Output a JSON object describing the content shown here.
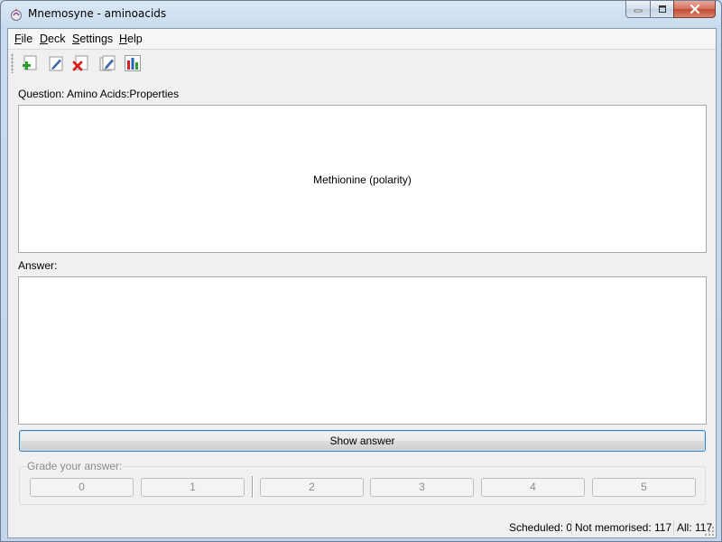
{
  "window": {
    "title": "Mnemosyne - aminoacids"
  },
  "menu": [
    {
      "label": "File",
      "underline": "F",
      "rest": "ile"
    },
    {
      "label": "Deck",
      "underline": "D",
      "rest": "eck"
    },
    {
      "label": "Settings",
      "underline": "S",
      "rest": "ettings"
    },
    {
      "label": "Help",
      "underline": "H",
      "rest": "elp"
    }
  ],
  "toolbar": {
    "icons": [
      "add-card-icon",
      "edit-card-icon",
      "delete-card-icon",
      "edit-deck-icon",
      "statistics-icon"
    ]
  },
  "question": {
    "label": "Question: Amino Acids:Properties",
    "text": "Methionine (polarity)"
  },
  "answer": {
    "label": "Answer:",
    "text": ""
  },
  "show_answer_label": "Show answer",
  "grade": {
    "legend": "Grade your answer:",
    "buttons": [
      "0",
      "1",
      "2",
      "3",
      "4",
      "5"
    ]
  },
  "status": {
    "scheduled": "Scheduled: 0",
    "not_memorised": "Not memorised: 117",
    "all": "All: 117"
  },
  "colors": {
    "accent": "#3c7fb1",
    "close_button": "#c24a33",
    "disabled_text": "#8d8d8d"
  }
}
